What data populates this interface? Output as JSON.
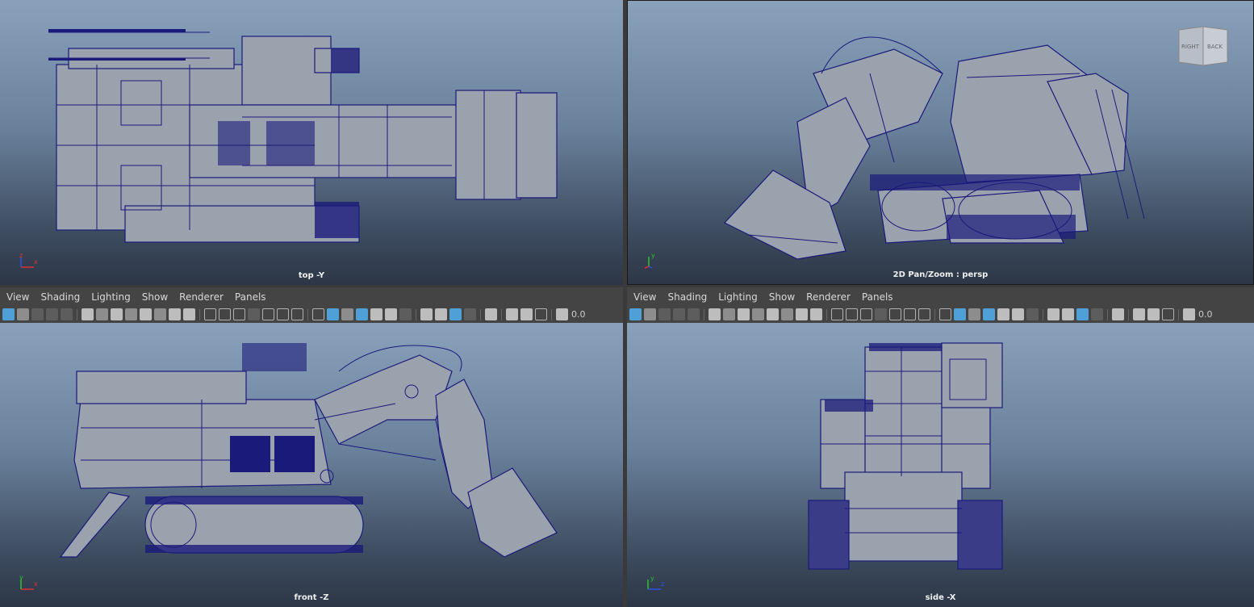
{
  "viewports": {
    "top_left": {
      "label": "top -Y",
      "axis_h": "x",
      "axis_v": "z"
    },
    "top_right": {
      "label": "2D Pan/Zoom : persp",
      "axis_v": "y",
      "axis_h": "x"
    },
    "bottom_left": {
      "label": "front -Z",
      "axis_v": "y",
      "axis_h": "x"
    },
    "bottom_right": {
      "label": "side -X",
      "axis_v": "y",
      "axis_h": "z"
    }
  },
  "viewcube": {
    "right": "RIGHT",
    "back": "BACK"
  },
  "menu_left": [
    "View",
    "Shading",
    "Lighting",
    "Show",
    "Renderer",
    "Panels"
  ],
  "menu_right": [
    "View",
    "Shading",
    "Lighting",
    "Show",
    "Renderer",
    "Panels"
  ],
  "toolbar_left": {
    "field_value": "0.0"
  },
  "toolbar_right": {
    "field_value": "0.0"
  },
  "colors": {
    "wire": "#1a1a7a",
    "surface": "#9aa2ae",
    "menu_bg": "#444444",
    "accent": "#4ea0d6"
  }
}
